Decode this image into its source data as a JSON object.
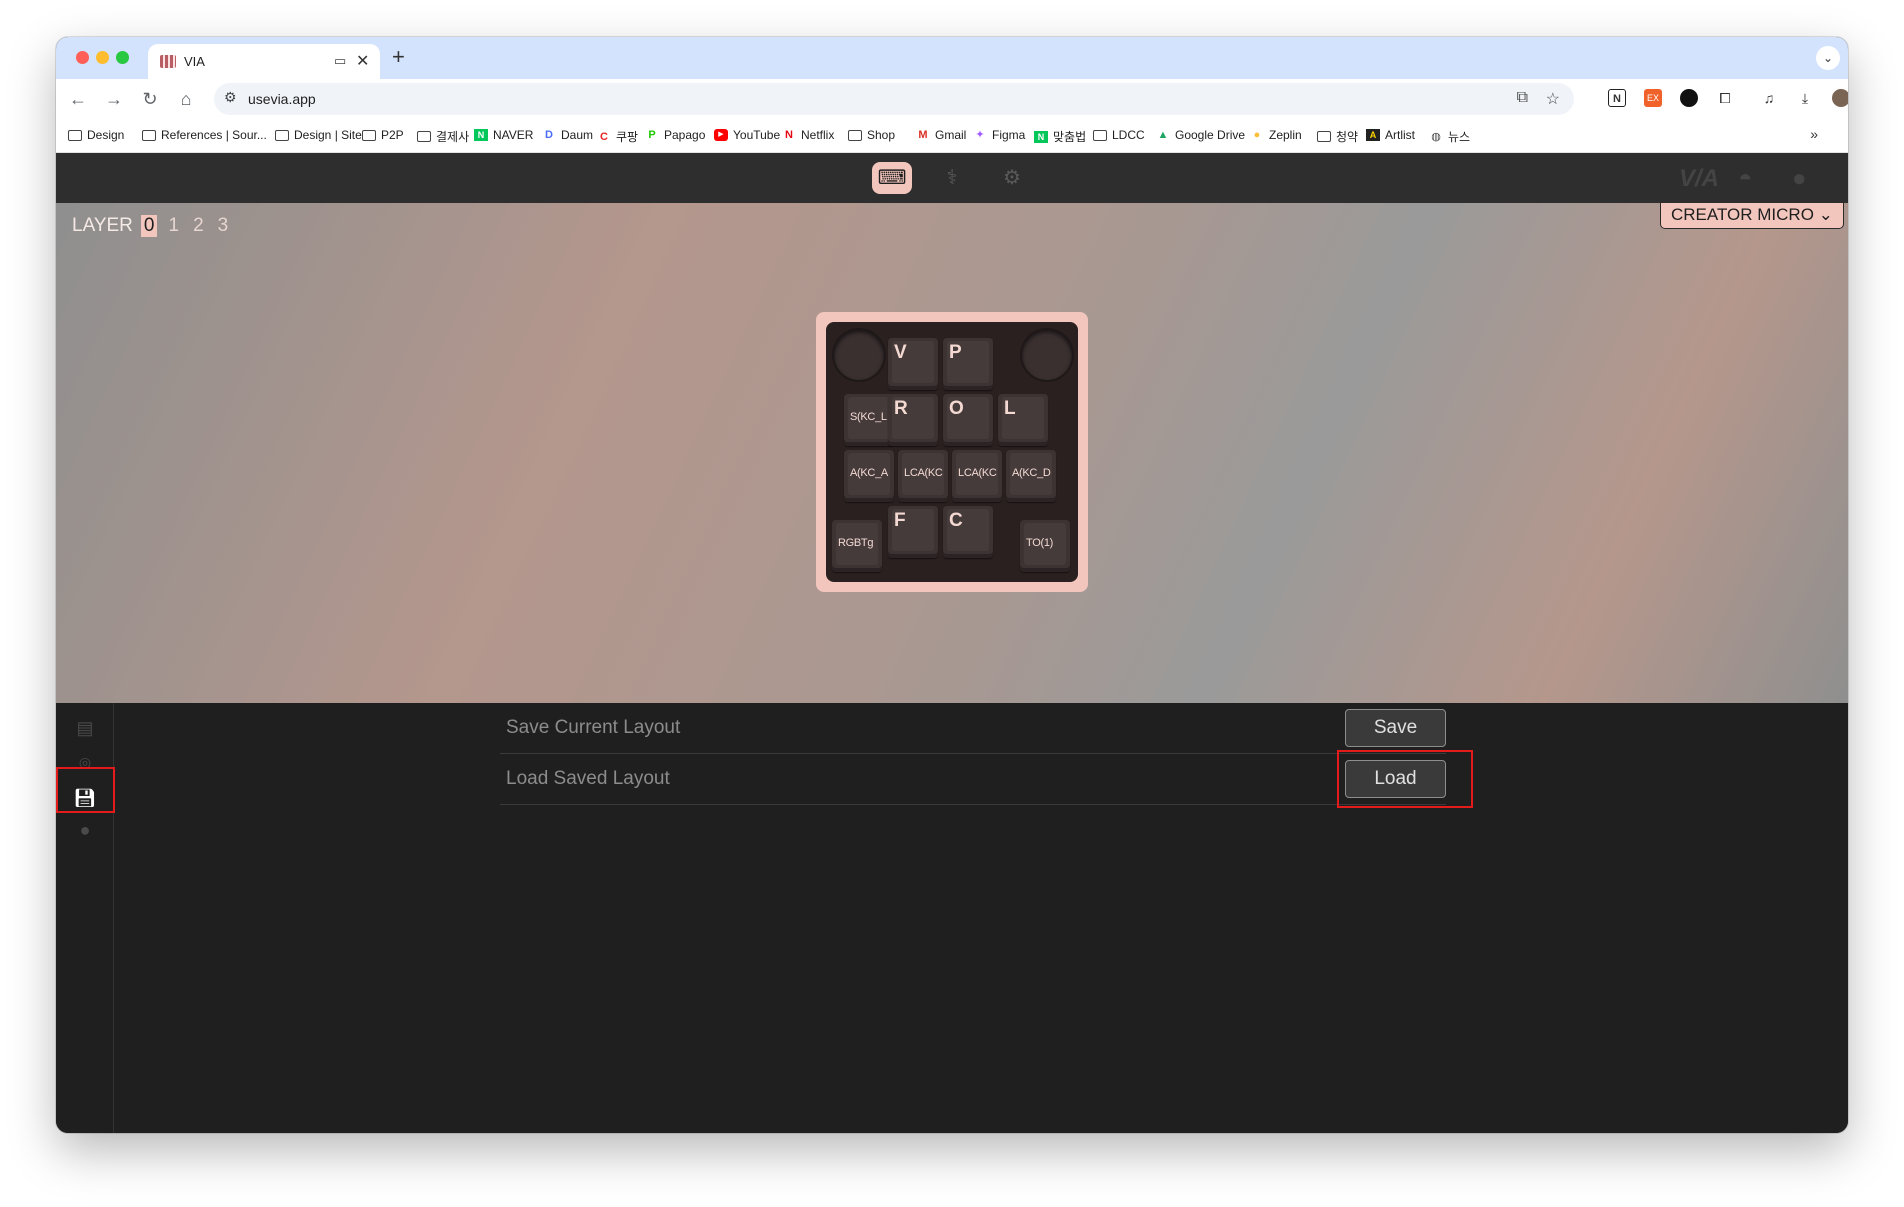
{
  "browser": {
    "tab_title": "VIA",
    "tab_close": "✕",
    "new_tab": "+",
    "url": "usevia.app",
    "icons": [
      "back-icon",
      "forward-icon",
      "reload-icon",
      "home-icon",
      "site-info-icon",
      "translate-icon",
      "star-icon",
      "notion-icon",
      "extension-ex-icon",
      "extension-circle-icon",
      "puzzle-icon",
      "media-icon",
      "download-icon",
      "profile-icon",
      "menu-icon"
    ]
  },
  "bookmarks": [
    {
      "label": "Design",
      "icon": "folder"
    },
    {
      "label": "References | Sour...",
      "icon": "folder"
    },
    {
      "label": "Design | Site",
      "icon": "folder"
    },
    {
      "label": "P2P",
      "icon": "folder"
    },
    {
      "label": "결제사",
      "icon": "folder"
    },
    {
      "label": "NAVER",
      "icon": "naver"
    },
    {
      "label": "Daum",
      "icon": "daum"
    },
    {
      "label": "쿠팡",
      "icon": "coupang"
    },
    {
      "label": "Papago",
      "icon": "papago"
    },
    {
      "label": "YouTube",
      "icon": "youtube"
    },
    {
      "label": "Netflix",
      "icon": "netflix"
    },
    {
      "label": "Shop",
      "icon": "folder"
    },
    {
      "label": "Gmail",
      "icon": "gmail"
    },
    {
      "label": "Figma",
      "icon": "figma"
    },
    {
      "label": "맞춤법",
      "icon": "naver"
    },
    {
      "label": "LDCC",
      "icon": "folder"
    },
    {
      "label": "Google Drive",
      "icon": "drive"
    },
    {
      "label": "Zeplin",
      "icon": "zeplin"
    },
    {
      "label": "청약",
      "icon": "folder"
    },
    {
      "label": "Artlist",
      "icon": "artlist"
    },
    {
      "label": "뉴스",
      "icon": "globe"
    }
  ],
  "bookmarks_more": "»",
  "via": {
    "layer_label": "LAYER",
    "layers": [
      "0",
      "1",
      "2",
      "3"
    ],
    "active_layer": "0",
    "device": "CREATOR MICRO",
    "header_right": "V/A",
    "keys": {
      "v": "V",
      "p": "P",
      "s_kc": "S(KC_L",
      "r": "R",
      "o": "O",
      "l": "L",
      "a_kc1": "A(KC_A",
      "lca1": "LCA(KC",
      "lca2": "LCA(KC",
      "a_kc2": "A(KC_D",
      "rgb": "RGBTg",
      "f": "F",
      "c": "C",
      "to1": "TO(1)"
    }
  },
  "panel": {
    "save_label": "Save Current Layout",
    "save_button": "Save",
    "load_label": "Load Saved Layout",
    "load_button": "Load"
  },
  "colors": {
    "accent": "#f3c6bd",
    "highlight_box": "#e31b1b",
    "panel_bg": "#1f1f1f"
  }
}
